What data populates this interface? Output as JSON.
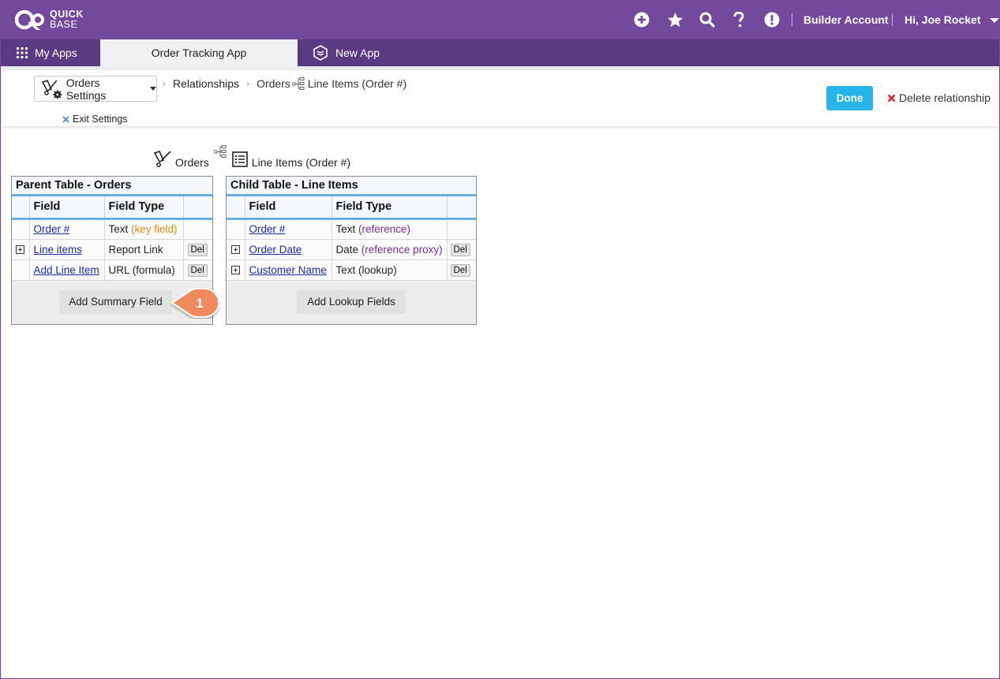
{
  "brand": {
    "line1": "QUICK",
    "line2": "BASE"
  },
  "header": {
    "builder_account": "Builder Account",
    "greeting": "Hi, Joe Rocket"
  },
  "tabs": {
    "my_apps": "My Apps",
    "order_tracking": "Order Tracking App",
    "new_app": "New App"
  },
  "settings": {
    "dropdown_label": "Orders Settings",
    "breadcrumb": {
      "relationships": "Relationships",
      "orders": "Orders",
      "line_items": "Line Items (Order #)"
    },
    "exit_label": "Exit Settings",
    "done_label": "Done",
    "delete_label": "Delete relationship"
  },
  "relationship_header": {
    "parent": "Orders",
    "child": "Line Items (Order #)"
  },
  "parent_table": {
    "title": "Parent Table - Orders",
    "col_field": "Field",
    "col_type": "Field Type",
    "rows": [
      {
        "field": "Order #",
        "type": "Text",
        "type_note": "(key field)"
      },
      {
        "field": "Line items",
        "type": "Report Link",
        "del": "Del"
      },
      {
        "field": "Add Line Item",
        "type": "URL (formula)",
        "del": "Del"
      }
    ],
    "button": "Add Summary Field"
  },
  "child_table": {
    "title": "Child Table - Line Items",
    "col_field": "Field",
    "col_type": "Field Type",
    "rows": [
      {
        "field": "Order #",
        "type": "Text",
        "type_note": "(reference)"
      },
      {
        "field": "Order Date",
        "type": "Date",
        "type_note": "(reference proxy)",
        "del": "Del"
      },
      {
        "field": "Customer Name",
        "type": "Text (lookup)",
        "del": "Del"
      }
    ],
    "button": "Add Lookup Fields"
  },
  "callout": {
    "number": "1"
  },
  "colors": {
    "brand_purple": "#74489d",
    "tab_dark": "#5a3a80",
    "done_blue": "#27b4e8",
    "callout_orange": "#f08a5d",
    "key_orange": "#ee8a1a",
    "ref_purple": "#7a2c9a"
  }
}
